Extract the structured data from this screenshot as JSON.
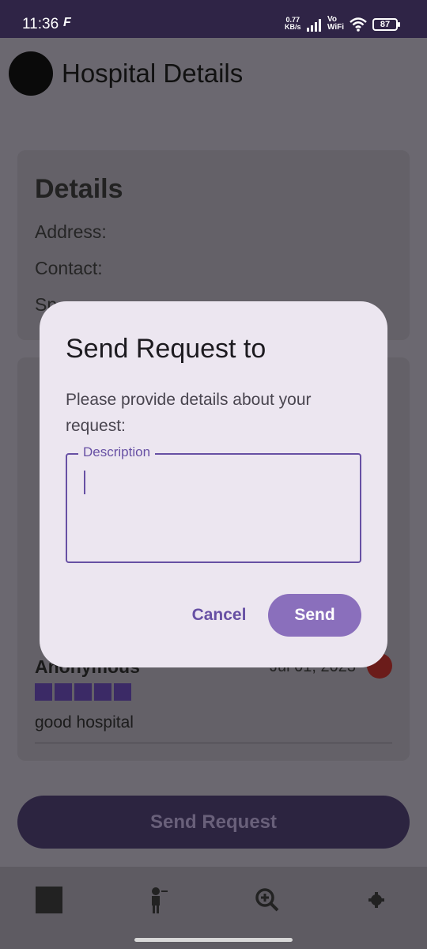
{
  "status_bar": {
    "time": "11:36",
    "network_speed": "0.77",
    "network_unit": "KB/s",
    "vo": "Vo",
    "wifi_label": "WiFi",
    "battery": "87"
  },
  "header": {
    "title": "Hospital Details"
  },
  "details_card": {
    "heading": "Details",
    "address_label": "Address:",
    "contact_label": "Contact:",
    "specialties_label": "Sp"
  },
  "reviews": [
    {
      "name": "Anonymous",
      "date": "Jul 01, 2023",
      "rating": 5,
      "text": "good hospital"
    }
  ],
  "send_request_button": "Send Request",
  "dialog": {
    "title": "Send Request to",
    "message": "Please provide details about your request:",
    "field_label": "Description",
    "field_value": "",
    "cancel_label": "Cancel",
    "send_label": "Send"
  },
  "colors": {
    "primary": "#6750a4",
    "send_button": "#8a6fbc",
    "dialog_bg": "#ece6f0",
    "status_bar": "#2f2446"
  },
  "bottom_nav": {
    "items": [
      "home-icon",
      "doctor-icon",
      "search-zoom-icon",
      "settings-icon"
    ]
  }
}
